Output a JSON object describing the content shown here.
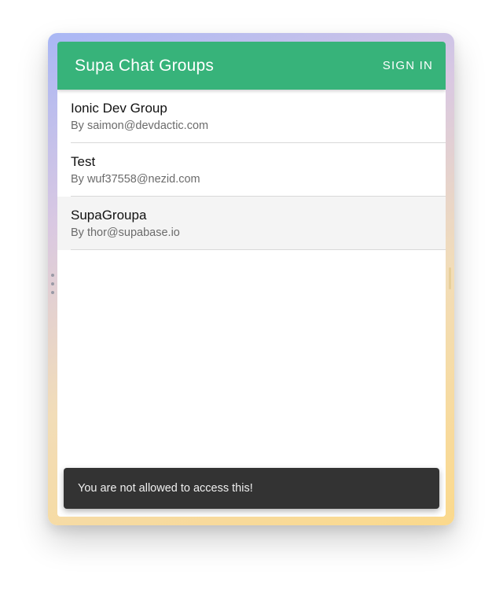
{
  "toolbar": {
    "title": "Supa Chat Groups",
    "signin_label": "SIGN IN",
    "color": "#37b37a"
  },
  "groups": [
    {
      "title": "Ionic Dev Group",
      "creator": "By saimon@devdactic.com"
    },
    {
      "title": "Test",
      "creator": "By wuf37558@nezid.com"
    },
    {
      "title": "SupaGroupa",
      "creator": "By thor@supabase.io"
    }
  ],
  "toast": {
    "message": "You are not allowed to access this!"
  }
}
